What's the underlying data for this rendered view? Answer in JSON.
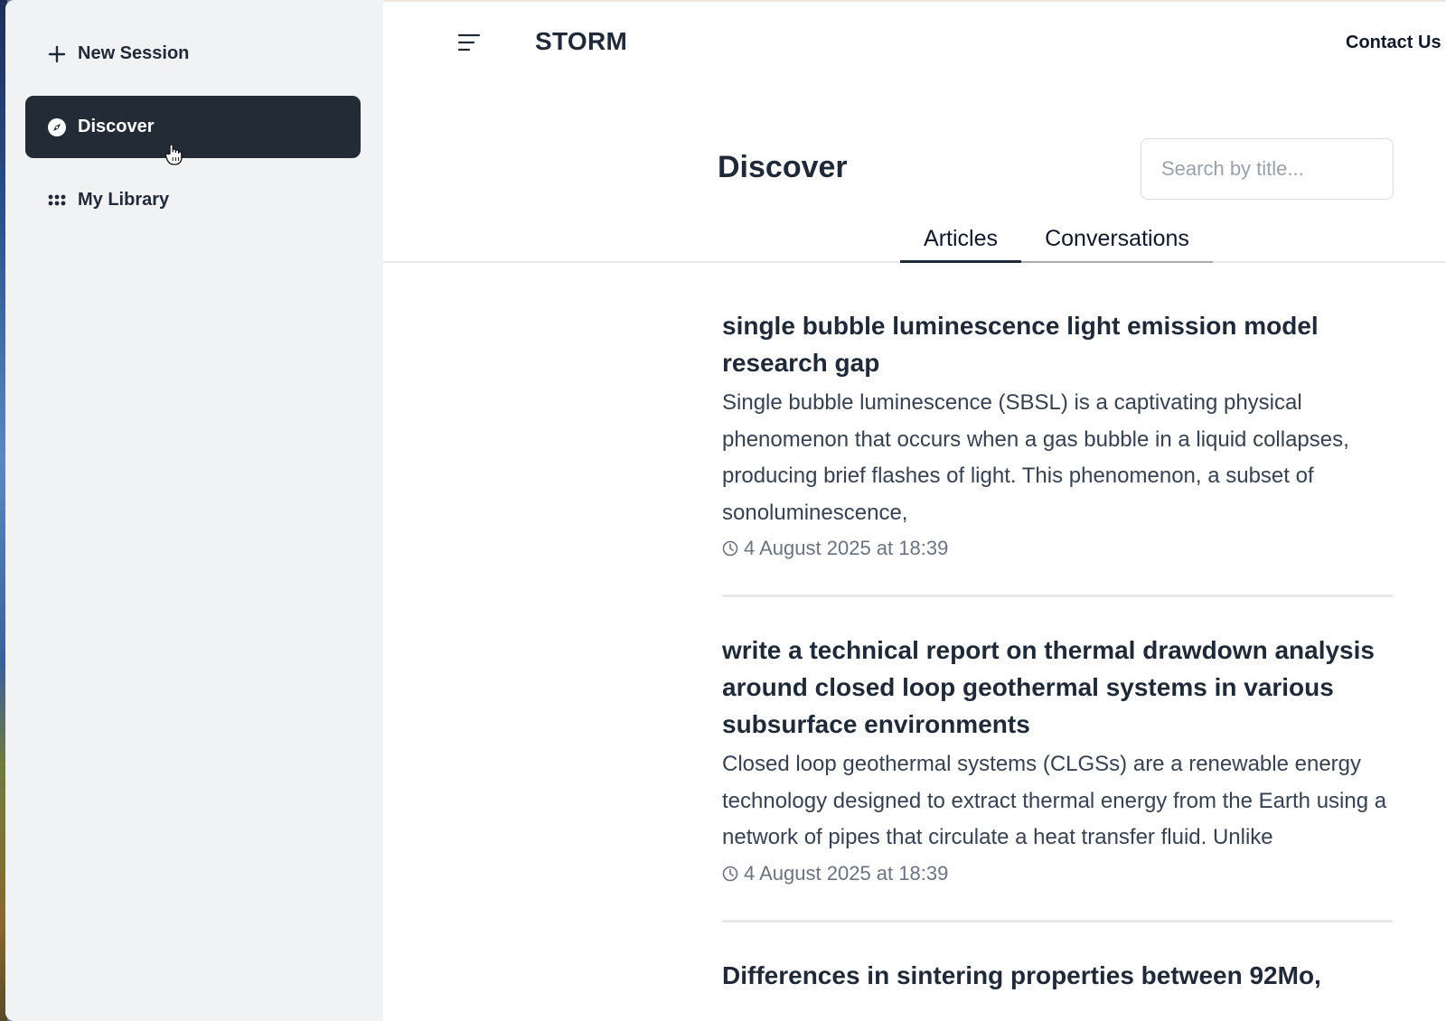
{
  "sidebar": {
    "new_session": "New Session",
    "discover": "Discover",
    "my_library": "My Library"
  },
  "header": {
    "brand": "STORM",
    "contact": "Contact Us"
  },
  "main": {
    "title": "Discover",
    "search_placeholder": "Search by title...",
    "tabs": [
      {
        "label": "Articles",
        "active": true
      },
      {
        "label": "Conversations",
        "active": false
      }
    ],
    "articles": [
      {
        "title": "single bubble luminescence light emission model research gap",
        "summary": "Single bubble luminescence (SBSL) is a captivating physical phenomenon that occurs when a gas bubble in a liquid collapses, producing brief flashes of light. This phenomenon, a subset of sonoluminescence,",
        "timestamp": "4 August 2025 at 18:39"
      },
      {
        "title": "write a technical report on thermal drawdown analysis around closed loop geothermal systems in various subsurface environments",
        "summary": "Closed loop geothermal systems (CLGSs) are a renewable energy technology designed to extract thermal energy from the Earth using a network of pipes that circulate a heat transfer fluid. Unlike",
        "timestamp": "4 August 2025 at 18:39"
      },
      {
        "title": "Differences in sintering properties between 92Mo,"
      }
    ]
  },
  "colors": {
    "sidebar_bg": "#f1f2f4",
    "active_item_bg": "#232b36",
    "text_dark": "#1f2937",
    "muted": "#6b7280"
  }
}
